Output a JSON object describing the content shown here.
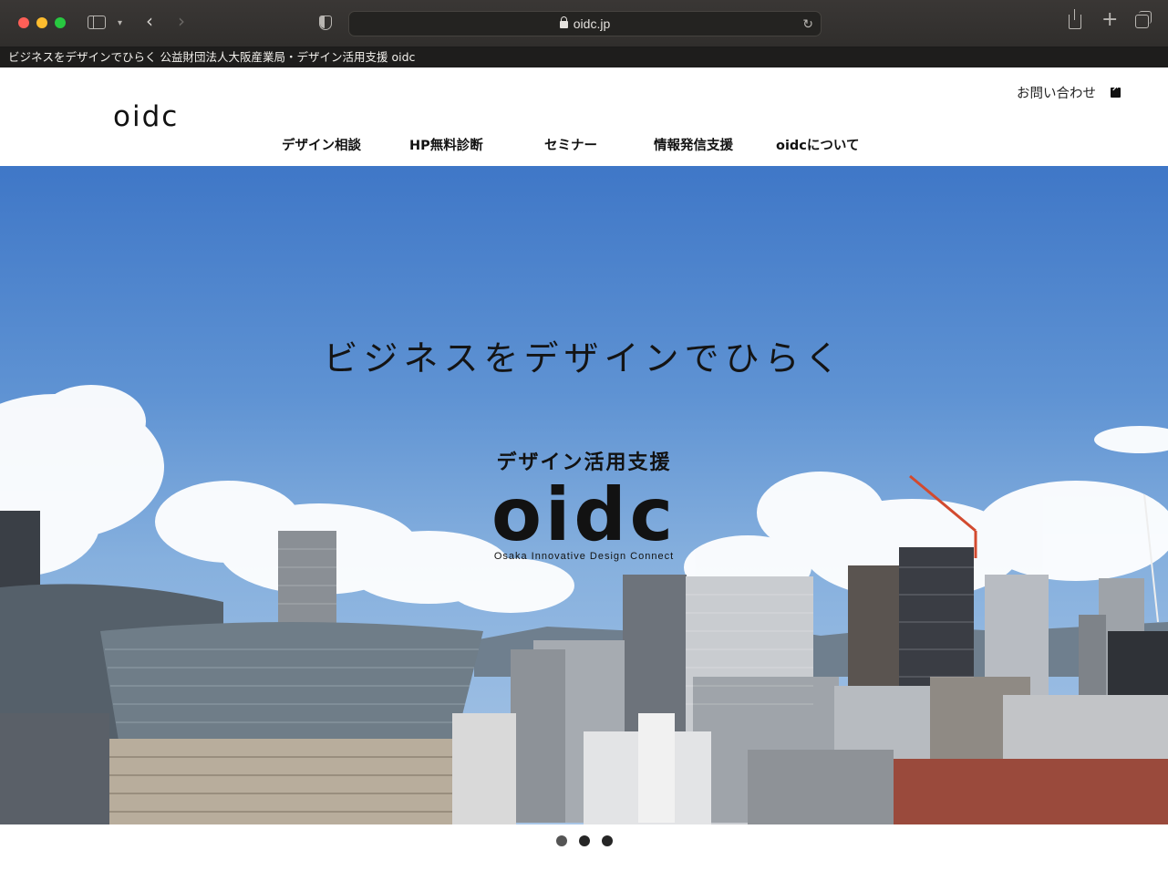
{
  "browser": {
    "url": "oidc.jp",
    "page_title": "ビジネスをデザインでひらく 公益財団法人大阪産業局・デザイン活用支援 oidc",
    "icons": [
      "sidebar-icon",
      "chevron-down-icon",
      "back-icon",
      "forward-icon",
      "shield-icon",
      "lock-icon",
      "reload-icon",
      "share-icon",
      "new-tab-icon",
      "tab-overview-icon"
    ]
  },
  "header": {
    "logo": "oidc",
    "contact_label": "お問い合わせ",
    "nav": [
      {
        "label": "デザイン相談"
      },
      {
        "label": "HP無料診断"
      },
      {
        "label": "セミナー"
      },
      {
        "label": "情報発信支援"
      },
      {
        "label": "oidcについて"
      }
    ]
  },
  "hero": {
    "tagline": "ビジネスをデザインでひらく",
    "subtitle": "デザイン活用支援",
    "logo": "oidc",
    "caption": "Osaka Innovative Design Connect"
  },
  "carousel": {
    "slides": 3,
    "active": 1
  }
}
